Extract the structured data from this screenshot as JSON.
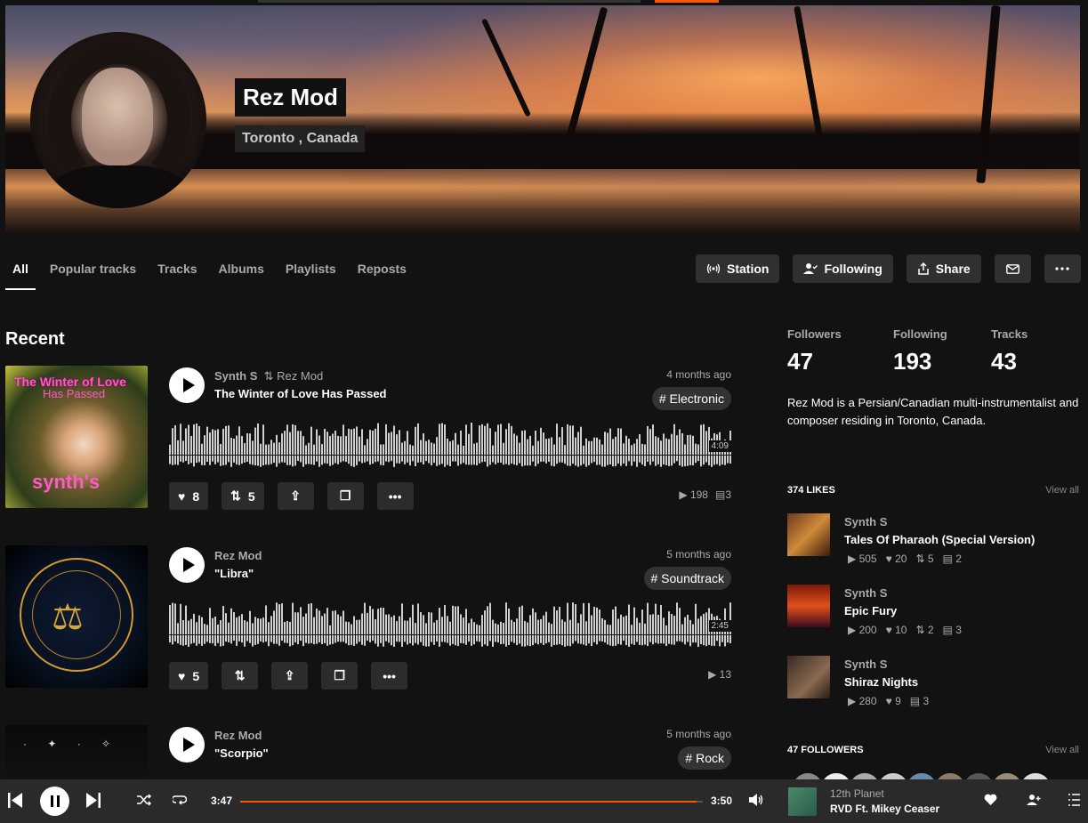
{
  "artist": {
    "name": "Rez Mod",
    "location": "Toronto , Canada"
  },
  "tabs": [
    {
      "label": "All",
      "active": true
    },
    {
      "label": "Popular tracks"
    },
    {
      "label": "Tracks"
    },
    {
      "label": "Albums"
    },
    {
      "label": "Playlists"
    },
    {
      "label": "Reposts"
    }
  ],
  "actions": {
    "station": "Station",
    "following": "Following",
    "share": "Share"
  },
  "recent": {
    "heading": "Recent",
    "tracks": [
      {
        "user": "Synth S",
        "repost_by": "Rez Mod",
        "title": "The Winter of Love Has Passed",
        "date": "4 months ago",
        "tag": "# Electronic",
        "duration": "4:09",
        "likes": "8",
        "reposts": "5",
        "plays": "198",
        "comments": "3",
        "art_text": {
          "line1": "The Winter of Love",
          "line2": "Has Passed",
          "line3": "synth's"
        }
      },
      {
        "user": "Rez Mod",
        "title": "\"Libra\"",
        "date": "5 months ago",
        "tag": "# Soundtrack",
        "duration": "2:45",
        "likes": "5",
        "plays": "13"
      },
      {
        "user": "Rez Mod",
        "title": "\"Scorpio\"",
        "date": "5 months ago",
        "tag": "# Rock"
      }
    ]
  },
  "sidebar": {
    "stats": [
      {
        "label": "Followers",
        "value": "47"
      },
      {
        "label": "Following",
        "value": "193"
      },
      {
        "label": "Tracks",
        "value": "43"
      }
    ],
    "bio": "Rez Mod is a Persian/Canadian multi-instrumentalist and composer residing in Toronto, Canada.",
    "likes_heading": "374 LIKES",
    "view_all": "View all",
    "likes": [
      {
        "user": "Synth S",
        "title": "Tales Of Pharaoh (Special Version)",
        "plays": "505",
        "likes": "20",
        "reposts": "5",
        "comments": "2"
      },
      {
        "user": "Synth S",
        "title": "Epic Fury",
        "plays": "200",
        "likes": "10",
        "reposts": "2",
        "comments": "3"
      },
      {
        "user": "Synth S",
        "title": "Shiraz Nights",
        "plays": "280",
        "likes": "9",
        "comments": "3"
      }
    ],
    "followers_heading": "47 FOLLOWERS"
  },
  "player": {
    "current_time": "3:47",
    "total_time": "3:50",
    "progress": 0.986,
    "artist": "12th Planet",
    "title": "RVD Ft. Mikey Ceaser"
  },
  "colors": {
    "accent": "#ff5500",
    "background": "#121212",
    "button": "#303030"
  }
}
